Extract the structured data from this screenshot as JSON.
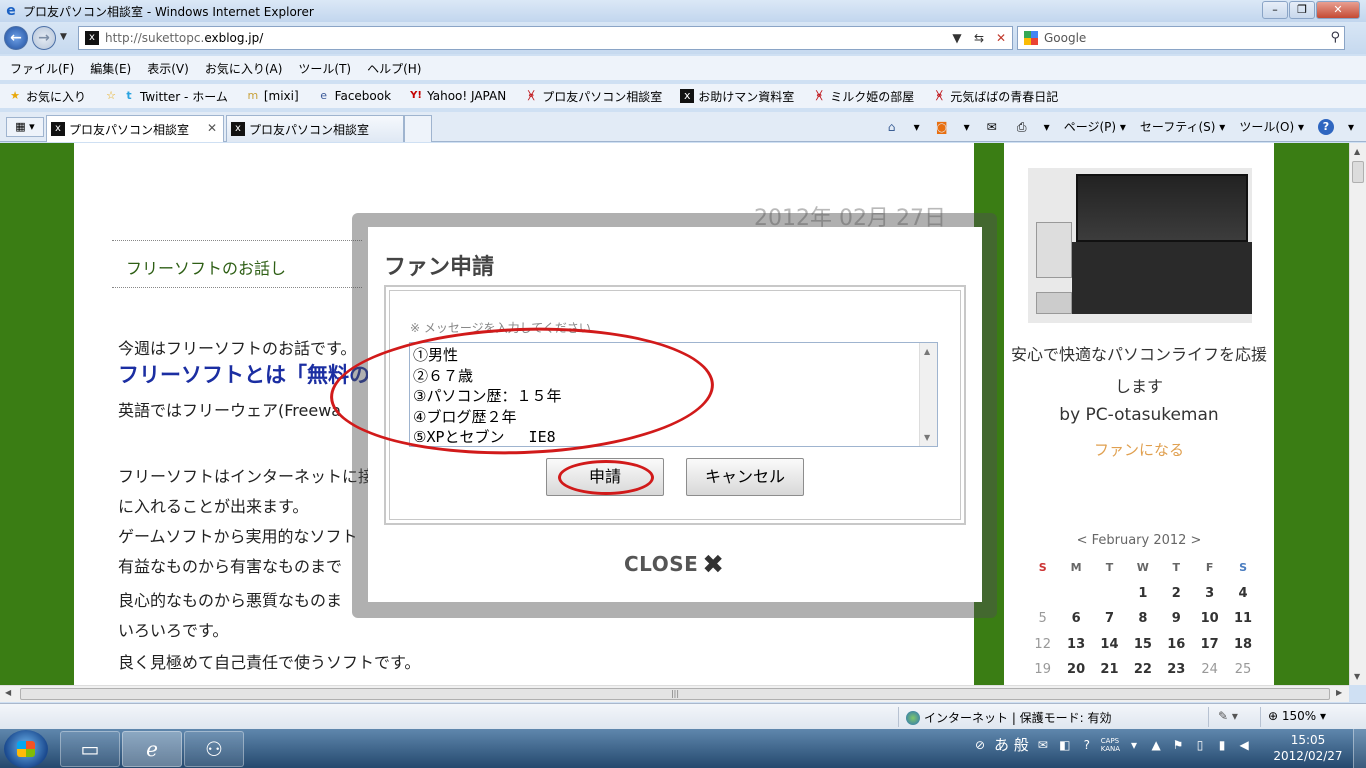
{
  "window": {
    "title": "プロ友パソコン相談室 - Windows Internet Explorer"
  },
  "address": {
    "url_prefix": "http://sukettopc.",
    "url_domain": "exblog.jp/",
    "search_placeholder": "Google"
  },
  "menu": [
    "ファイル(F)",
    "編集(E)",
    "表示(V)",
    "お気に入り(A)",
    "ツール(T)",
    "ヘルプ(H)"
  ],
  "favorites": {
    "label": "お気に入り",
    "items": [
      {
        "label": "Twitter - ホーム",
        "icon": "twitter-icon"
      },
      {
        "label": "[mixi]",
        "icon": "mixi-icon"
      },
      {
        "label": "Facebook",
        "icon": "facebook-icon"
      },
      {
        "label": "Yahoo! JAPAN",
        "icon": "yahoo-icon"
      },
      {
        "label": "プロ友パソコン相談室",
        "icon": "exblog-red-icon"
      },
      {
        "label": "お助けマン資料室",
        "icon": "exblog-black-icon"
      },
      {
        "label": "ミルク姫の部屋",
        "icon": "exblog-red-icon"
      },
      {
        "label": "元気ばばの青春日記",
        "icon": "exblog-red-icon"
      }
    ]
  },
  "tabs": [
    {
      "label": "プロ友パソコン相談室",
      "active": true
    },
    {
      "label": "プロ友パソコン相談室",
      "active": false
    }
  ],
  "commandbar": {
    "page": "ページ(P)",
    "safety": "セーフティ(S)",
    "tools": "ツール(O)"
  },
  "post": {
    "date": "2012年 02月 27日",
    "title": "フリーソフトのお話し",
    "lines": [
      "今週はフリーソフトのお話です。",
      "フリーソフトとは「無料の",
      "英語ではフリーウェア(Freewa",
      "フリーソフトはインターネットに接",
      "に入れることが出来ます。",
      "ゲームソフトから実用的なソフト",
      "有益なものから有害なものまで",
      "良心的なものから悪質なものま",
      "いろいろです。",
      "良く見極めて自己責任で使うソフトです。"
    ]
  },
  "sidebar": {
    "tagline": "安心で快適なパソコンライフを応援します",
    "byline": "by PC-otasukeman",
    "fan_link": "ファンになる",
    "calendar": {
      "header": "< February 2012 >",
      "dow": [
        "S",
        "M",
        "T",
        "W",
        "T",
        "F",
        "S"
      ],
      "weeks": [
        [
          "",
          "",
          "",
          "1",
          "2",
          "3",
          "4"
        ],
        [
          "5",
          "6",
          "7",
          "8",
          "9",
          "10",
          "11"
        ],
        [
          "12",
          "13",
          "14",
          "15",
          "16",
          "17",
          "18"
        ],
        [
          "19",
          "20",
          "21",
          "22",
          "23",
          "24",
          "25"
        ]
      ]
    }
  },
  "dialog": {
    "title": "ファン申請",
    "message_label": "※ メッセージを入力してください",
    "message_text": "①男性\n②６７歳\n③パソコン歴：１５年\n④ブログ歴２年\n⑤XPとセブン　 IE8",
    "apply_label": "申請",
    "cancel_label": "キャンセル",
    "close_label": "CLOSE"
  },
  "status": {
    "zone": "インターネット | 保護モード: 有効",
    "zoom": "150%"
  },
  "taskbar": {
    "ime": "あ 般",
    "caps": "CAPS",
    "kana": "KANA",
    "time": "15:05",
    "date": "2012/02/27"
  }
}
